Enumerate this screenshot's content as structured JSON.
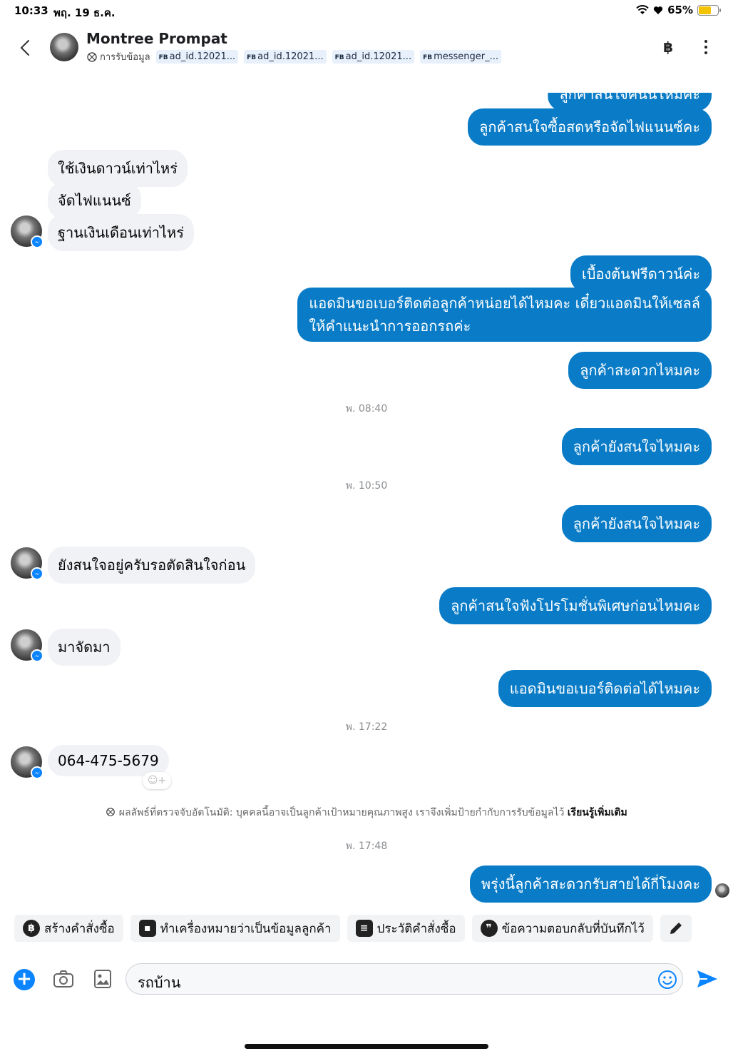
{
  "status_bar": {
    "time": "10:33",
    "date": "พฤ. 19 ธ.ค.",
    "battery": "65%",
    "battery_level": 0.65
  },
  "header": {
    "contact_name": "Montree Prompat",
    "label": "การรับข้อมูล",
    "tags": [
      {
        "prefix": "FB",
        "text": "ad_id.12021..."
      },
      {
        "prefix": "FB",
        "text": "ad_id.12021..."
      },
      {
        "prefix": "FB",
        "text": "ad_id.12021..."
      },
      {
        "prefix": "FB",
        "text": "messenger_..."
      }
    ],
    "baht_symbol": "฿"
  },
  "messages": [
    {
      "dir": "out",
      "text": "ลูกค้าสนใจคันนี้ไหมคะ"
    },
    {
      "dir": "out",
      "text": "ลูกค้าสนใจซื้อสดหรือจัดไฟแนนซ์คะ"
    },
    {
      "dir": "in",
      "text": "ใช้เงินดาวน์เท่าไหร่"
    },
    {
      "dir": "in",
      "text": "จัดไฟแนนซ์"
    },
    {
      "dir": "in",
      "text": "ฐานเงินเดือนเท่าไหร่"
    },
    {
      "dir": "out",
      "text": "เบื้องต้นฟรีดาวน์ค่ะ"
    },
    {
      "dir": "out",
      "text": "แอดมินขอเบอร์ติดต่อลูกค้าหน่อยได้ไหมคะ เดี๋ยวแอดมินให้เซลล์",
      "text2": "ให้คำแนะนำการออกรถค่ะ"
    },
    {
      "dir": "out",
      "text": "ลูกค้าสะดวกไหมคะ"
    },
    {
      "dir": "time",
      "text": "พ. 08:40"
    },
    {
      "dir": "out",
      "text": "ลูกค้ายังสนใจไหมคะ"
    },
    {
      "dir": "time",
      "text": "พ. 10:50"
    },
    {
      "dir": "out",
      "text": "ลูกค้ายังสนใจไหมคะ"
    },
    {
      "dir": "in",
      "text": "ยังสนใจอยู่ครับรอตัดสินใจก่อน"
    },
    {
      "dir": "out",
      "text": "ลูกค้าสนใจฟังโปรโมชั่นพิเศษก่อนไหมคะ"
    },
    {
      "dir": "in",
      "text": "มาจัดมา"
    },
    {
      "dir": "out",
      "text": "แอดมินขอเบอร์ติดต่อได้ไหมคะ"
    },
    {
      "dir": "time",
      "text": "พ. 17:22"
    },
    {
      "dir": "in",
      "text": "064-475-5679"
    },
    {
      "dir": "time",
      "text": "พ. 17:48"
    },
    {
      "dir": "out",
      "text": "พรุ่งนี้ลูกค้าสะดวกรับสายได้กี่โมงคะ"
    }
  ],
  "notice": {
    "text": "ผลลัพธ์ที่ตรวจจับอัตโนมัติ: บุคคลนี้อาจเป็นลูกค้าเป้าหมายคุณภาพสูง เราจึงเพิ่มป้ายกำกับการรับข้อมูลไว้ ",
    "link": "เรียนรู้เพิ่มเติม"
  },
  "quick_actions": [
    {
      "label": "สร้างคำสั่งซื้อ",
      "icon": "baht-circle-icon",
      "glyph": "฿"
    },
    {
      "label": "ทำเครื่องหมายว่าเป็นข้อมูลลูกค้า",
      "icon": "id-card-icon",
      "glyph": "▪"
    },
    {
      "label": "ประวัติคำสั่งซื้อ",
      "icon": "list-icon",
      "glyph": "≡"
    },
    {
      "label": "ข้อความตอบกลับที่บันทึกไว้",
      "icon": "chat-bubbles-icon",
      "glyph": "❞"
    }
  ],
  "composer": {
    "value": "รถบ้าน"
  },
  "colors": {
    "outgoing_bubble": "#0a7cc7",
    "incoming_bubble": "#f0f2f5",
    "accent": "#0b84ff"
  }
}
